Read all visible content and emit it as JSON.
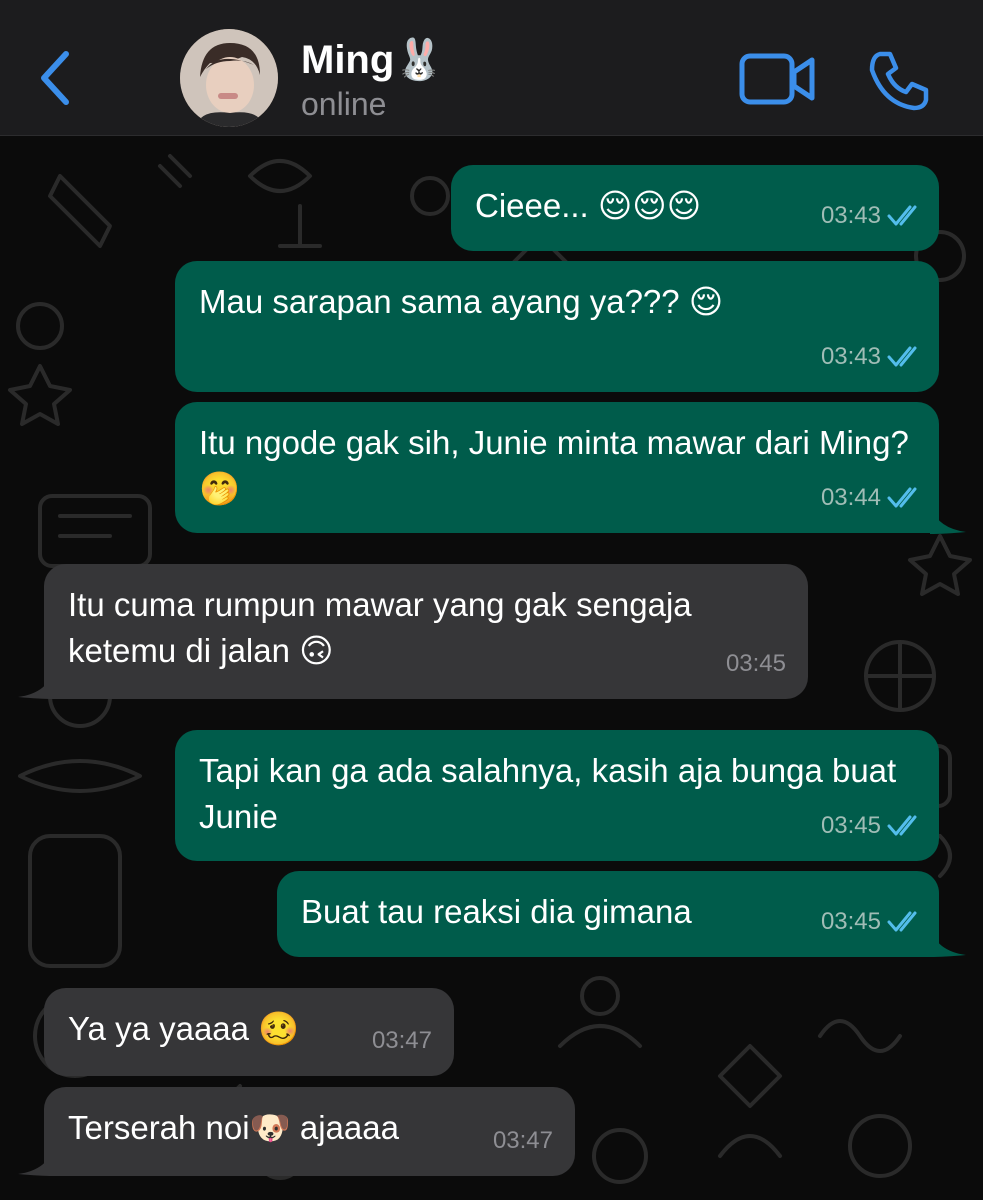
{
  "header": {
    "contact_name": "Ming",
    "contact_emoji": "🐰",
    "status": "online",
    "accent_color": "#3b8eea"
  },
  "icons": [
    "back-chevron-icon",
    "video-call-icon",
    "phone-call-icon",
    "double-check-icon"
  ],
  "messages": [
    {
      "direction": "outgoing",
      "text": "Cieee... 😌😌😌",
      "time": "03:43",
      "read": true
    },
    {
      "direction": "outgoing",
      "text": "Mau sarapan sama ayang ya??? 😌",
      "time": "03:43",
      "read": true
    },
    {
      "direction": "outgoing",
      "text": "Itu ngode gak sih, Junie minta mawar dari Ming? 🤭",
      "time": "03:44",
      "read": true
    },
    {
      "direction": "incoming",
      "text": "Itu cuma rumpun mawar yang gak sengaja ketemu di jalan 🙃",
      "time": "03:45"
    },
    {
      "direction": "outgoing",
      "text": "Tapi kan ga ada salahnya, kasih aja bunga buat Junie",
      "time": "03:45",
      "read": true
    },
    {
      "direction": "outgoing",
      "text": "Buat tau reaksi dia gimana",
      "time": "03:45",
      "read": true
    },
    {
      "direction": "incoming",
      "text": "Ya ya yaaaa 🥴",
      "time": "03:47"
    },
    {
      "direction": "incoming",
      "text": "Terserah noi🐶 ajaaaa",
      "time": "03:47"
    }
  ],
  "colors": {
    "outgoing_bubble": "#005c4b",
    "incoming_bubble": "#363638",
    "read_ticks": "#53bdeb",
    "header_bg": "#1c1c1e"
  }
}
